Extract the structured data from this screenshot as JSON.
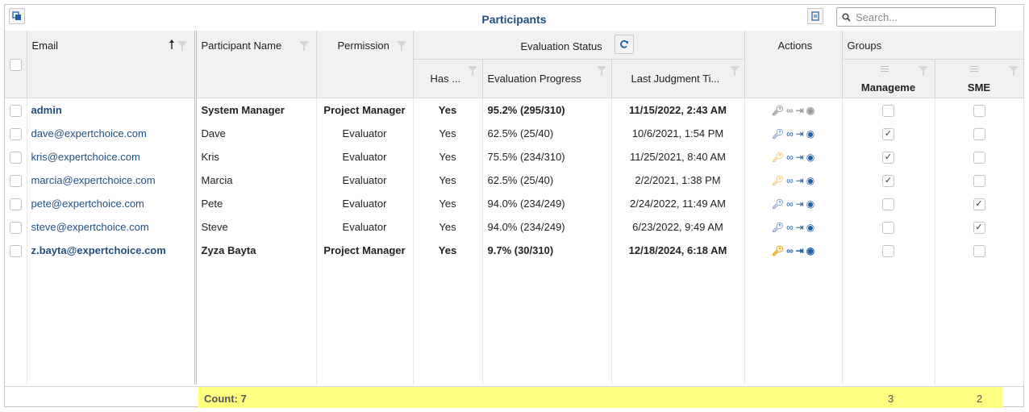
{
  "title": "Participants",
  "search": {
    "placeholder": "Search..."
  },
  "header": {
    "email": "Email",
    "participant_name": "Participant Name",
    "permission": "Permission",
    "evaluation_status": "Evaluation Status",
    "has": "Has ...",
    "evaluation_progress": "Evaluation Progress",
    "last_judgment": "Last Judgment Ti...",
    "actions": "Actions",
    "groups": "Groups",
    "group_management": "Manageme",
    "group_sme": "SME"
  },
  "rows": [
    {
      "email": "admin",
      "name": "System Manager",
      "permission": "Project Manager",
      "has": "Yes",
      "progress": "95.2% (295/310)",
      "last": "11/15/2022, 2:43 AM",
      "key": "gray",
      "mgmt": false,
      "sme": false,
      "bold": true
    },
    {
      "email": "dave@expertchoice.com",
      "name": "Dave",
      "permission": "Evaluator",
      "has": "Yes",
      "progress": "62.5% (25/40)",
      "last": "10/6/2021, 1:54 PM",
      "key": "blue",
      "mgmt": true,
      "sme": false,
      "bold": false
    },
    {
      "email": "kris@expertchoice.com",
      "name": "Kris",
      "permission": "Evaluator",
      "has": "Yes",
      "progress": "75.5% (234/310)",
      "last": "11/25/2021, 8:40 AM",
      "key": "orange",
      "mgmt": true,
      "sme": false,
      "bold": false
    },
    {
      "email": "marcia@expertchoice.com",
      "name": "Marcia",
      "permission": "Evaluator",
      "has": "Yes",
      "progress": "62.5% (25/40)",
      "last": "2/2/2021, 1:38 PM",
      "key": "orange",
      "mgmt": true,
      "sme": false,
      "bold": false
    },
    {
      "email": "pete@expertchoice.com",
      "name": "Pete",
      "permission": "Evaluator",
      "has": "Yes",
      "progress": "94.0% (234/249)",
      "last": "2/24/2022, 11:49 AM",
      "key": "blue",
      "mgmt": false,
      "sme": true,
      "bold": false
    },
    {
      "email": "steve@expertchoice.com",
      "name": "Steve",
      "permission": "Evaluator",
      "has": "Yes",
      "progress": "94.0% (234/249)",
      "last": "6/23/2022, 9:49 AM",
      "key": "blue",
      "mgmt": false,
      "sme": true,
      "bold": false
    },
    {
      "email": "z.bayta@expertchoice.com",
      "name": "Zyza Bayta",
      "permission": "Project Manager",
      "has": "Yes",
      "progress": "9.7% (30/310)",
      "last": "12/18/2024, 6:18 AM",
      "key": "orange",
      "mgmt": false,
      "sme": false,
      "bold": true
    }
  ],
  "footer": {
    "count": "Count: 7",
    "management_total": "3",
    "sme_total": "2"
  },
  "colors": {
    "title": "#1f4f7f",
    "link": "#1f4f7f",
    "key_blue": "#1f5fa8",
    "key_orange": "#f0a000",
    "footer_highlight": "#ffff80"
  },
  "icons": {
    "key": "key-icon",
    "link": "link-icon",
    "login": "login-icon",
    "view": "eye-icon",
    "refresh": "refresh-icon",
    "sort": "sort-asc-icon",
    "filter": "filter-icon",
    "search": "search-icon"
  }
}
